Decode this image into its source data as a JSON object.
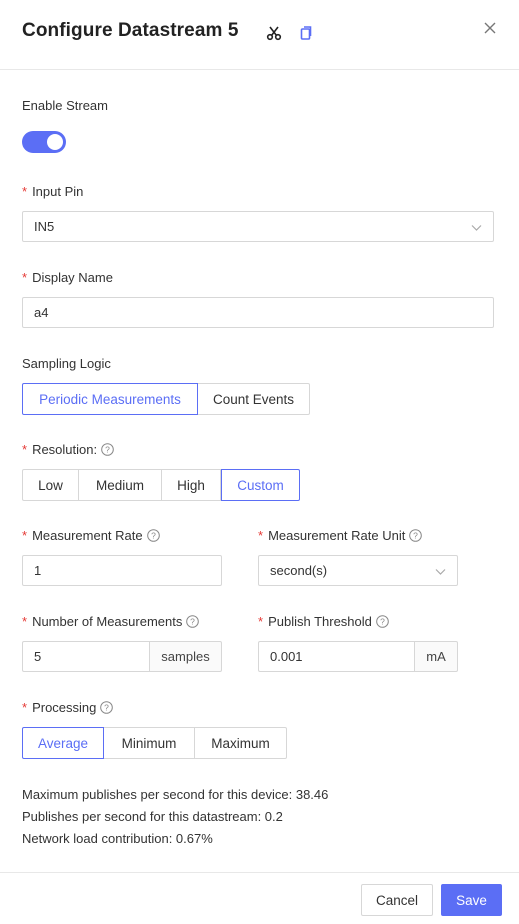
{
  "header": {
    "title": "Configure Datastream 5",
    "cut_icon": "scissors-icon",
    "copy_icon": "copy-icon",
    "close_icon": "close-icon"
  },
  "enable": {
    "label": "Enable Stream",
    "on": true
  },
  "input_pin": {
    "label": "Input Pin",
    "value": "IN5"
  },
  "display_name": {
    "label": "Display Name",
    "value": "a4"
  },
  "sampling": {
    "label": "Sampling Logic",
    "options": [
      "Periodic Measurements",
      "Count Events"
    ],
    "selected": "Periodic Measurements"
  },
  "resolution": {
    "label": "Resolution:",
    "options": [
      "Low",
      "Medium",
      "High",
      "Custom"
    ],
    "selected": "Custom"
  },
  "measurement_rate": {
    "label": "Measurement Rate",
    "value": "1"
  },
  "measurement_rate_unit": {
    "label": "Measurement Rate Unit",
    "value": "second(s)"
  },
  "num_measurements": {
    "label": "Number of Measurements",
    "value": "5",
    "suffix": "samples"
  },
  "publish_threshold": {
    "label": "Publish Threshold",
    "value": "0.001",
    "suffix": "mA"
  },
  "processing": {
    "label": "Processing",
    "options": [
      "Average",
      "Minimum",
      "Maximum"
    ],
    "selected": "Average"
  },
  "info": {
    "line1": "Maximum publishes per second for this device: 38.46",
    "line2": "Publishes per second for this datastream: 0.2",
    "line3": "Network load contribution: 0.67%"
  },
  "footer": {
    "cancel": "Cancel",
    "save": "Save"
  },
  "colors": {
    "accent": "#5b6ef5",
    "required": "#e53935"
  }
}
